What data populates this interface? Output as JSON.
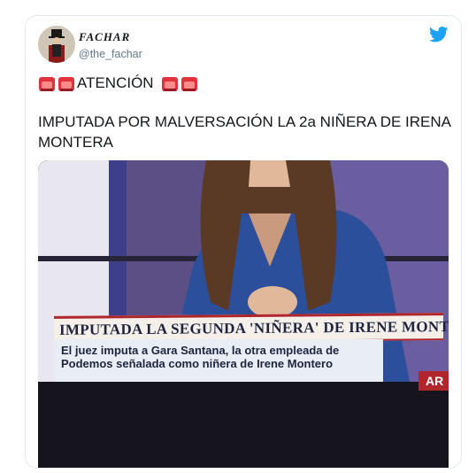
{
  "tweet": {
    "display_name": "FACHAR",
    "handle": "@the_fachar",
    "line1_text": "ATENCIÓN",
    "line2_text": "IMPUTADA POR MALVERSACIÓN LA 2a NIÑERA DE IRENA MONTERA"
  },
  "media": {
    "caption_title": "IMPUTADA LA SEGUNDA 'NIÑERA' DE IRENE MONTERO",
    "caption_sub": "El juez imputa a Gara Santana, la otra empleada de Podemos señalada como niñera de Irene Montero",
    "channel_logo": "AR"
  },
  "colors": {
    "twitter_blue": "#1da1f2",
    "siren_red": "#e0313d",
    "caption_red": "#b0262d"
  }
}
